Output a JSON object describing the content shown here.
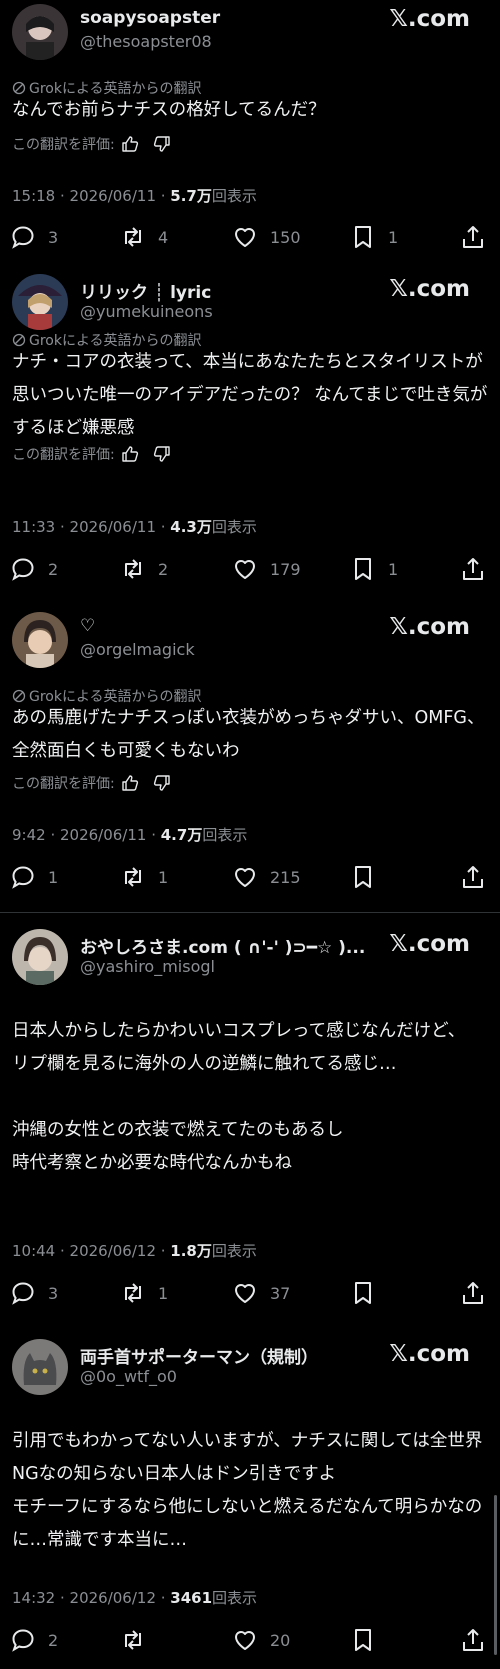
{
  "brand": "𝕏.com",
  "translation_label": "Grokによる英語からの翻訳",
  "rate_label": "この翻訳を評価:",
  "views_suffix": "回表示",
  "posts": [
    {
      "name": "soapysoapster",
      "handle": "@thesoapster08",
      "translated": true,
      "text": "なんでお前らナチスの格好してるんだ？",
      "time": "15:18 · 2026/06/11 · ",
      "views": "5.7万",
      "replies": "3",
      "reposts": "4",
      "likes": "150",
      "bookmarks": "1"
    },
    {
      "name": "リリック ┊ lyric",
      "handle": "@yumekuineons",
      "translated": true,
      "text": "ナチ・コアの衣装って、本当にあなたたちとスタイリストが思いついた唯一のアイデアだったの？ なんてまじで吐き気がするほど嫌悪感",
      "time": "11:33 · 2026/06/11 · ",
      "views": "4.3万",
      "replies": "2",
      "reposts": "2",
      "likes": "179",
      "bookmarks": "1"
    },
    {
      "name": "♡",
      "handle": "@orgelmagick",
      "translated": true,
      "text": "あの馬鹿げたナチスっぽい衣装がめっちゃダサい、OMFG、全然面白くも可愛くもないわ",
      "time": "9:42 · 2026/06/11 · ",
      "views": "4.7万",
      "replies": "1",
      "reposts": "1",
      "likes": "215",
      "bookmarks": ""
    },
    {
      "name": "おやしろさま.com ( ∩'-' )⊃━☆ )...",
      "handle": "@yashiro_misogl",
      "translated": false,
      "text": "日本人からしたらかわいいコスプレって感じなんだけど、\nリプ欄を見るに海外の人の逆鱗に触れてる感じ…\n\n沖縄の女性との衣装で燃えてたのもあるし\n時代考察とか必要な時代なんかもね",
      "time": "10:44 · 2026/06/12 · ",
      "views": "1.8万",
      "replies": "3",
      "reposts": "1",
      "likes": "37",
      "bookmarks": ""
    },
    {
      "name": "両手首サポーターマン（規制）",
      "handle": "@0o_wtf_o0",
      "translated": false,
      "text": "引用でもわかってない人いますが、ナチスに関しては全世界NGなの知らない日本人はドン引きですよ\nモチーフにするなら他にしないと燃えるだなんて明らかなのに…常識です本当に…",
      "time": "14:32 · 2026/06/12 · ",
      "views": "3461",
      "replies": "2",
      "reposts": "",
      "likes": "20",
      "bookmarks": ""
    }
  ],
  "icons": {
    "reply": "speech-bubble-icon",
    "repost": "repost-arrows-icon",
    "like": "heart-icon",
    "bookmark": "bookmark-icon",
    "share": "share-upload-icon"
  }
}
